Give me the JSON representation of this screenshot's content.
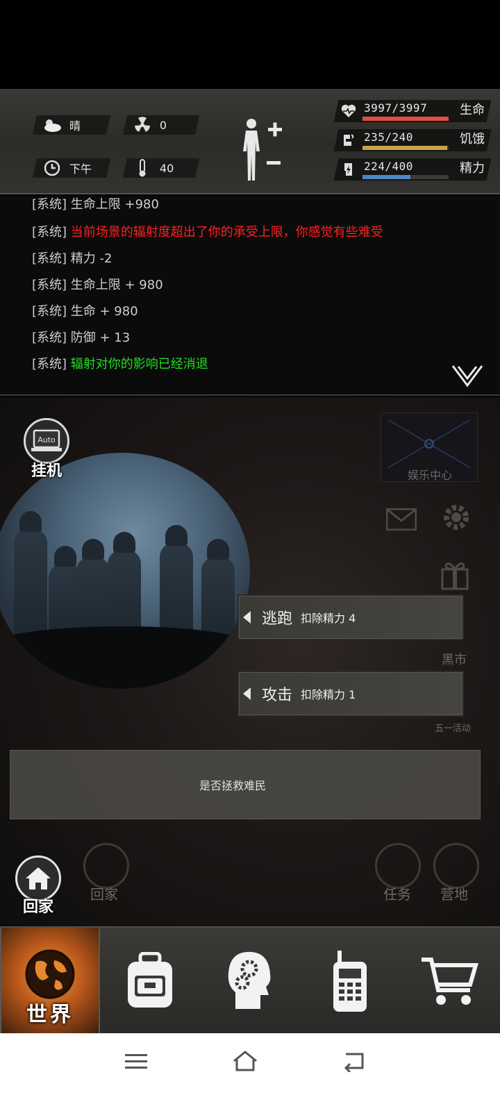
{
  "status": {
    "weather": "晴",
    "radiation": "0",
    "time_of_day": "下午",
    "temperature": "40",
    "health": {
      "value": "3997/3997",
      "label": "生命",
      "fill": 1.0,
      "color": "#e0503c"
    },
    "hunger": {
      "value": "235/240",
      "label": "饥饿",
      "fill": 0.98,
      "color": "#caa24a"
    },
    "energy": {
      "value": "224/400",
      "label": "精力",
      "fill": 0.56,
      "color": "#4f86c6"
    }
  },
  "log": {
    "partial_top": "[系统] 生命上限 +980",
    "lines": [
      {
        "tag": "[系统]",
        "msg": "当前场景的辐射度超出了你的承受上限，你感觉有些难受"
      },
      {
        "tag": "[系统]",
        "msg": "精力 -2"
      },
      {
        "tag": "[系统]",
        "msg": "生命上限 + 980"
      },
      {
        "tag": "[系统]",
        "msg": "生命 + 980"
      },
      {
        "tag": "[系统]",
        "msg": "防御 + 13"
      },
      {
        "tag": "[系统]",
        "msg": "辐射对你的影响已经消退"
      }
    ]
  },
  "scene": {
    "auto_icon_text": "Auto",
    "auto_label": "挂机",
    "entertainment": "娱乐中心",
    "black_market": "黑市",
    "may_day_event": "五一活动",
    "ghost_home": "回家",
    "ghost_quest": "任务",
    "ghost_camp": "营地",
    "home_label": "回家"
  },
  "actions": [
    {
      "name": "逃跑",
      "cost": "扣除精力 4"
    },
    {
      "name": "攻击",
      "cost": "扣除精力 1"
    }
  ],
  "prompt": "是否拯救难民",
  "nav": {
    "world": "世界"
  },
  "icons": [
    "weather-cloud-icon",
    "radiation-icon",
    "clock-icon",
    "thermometer-icon",
    "body-icon",
    "heart-icon",
    "hunger-icon",
    "energy-icon",
    "backpack-icon",
    "brain-icon",
    "radio-icon",
    "cart-icon",
    "globe-icon",
    "home-icon",
    "mail-icon",
    "settings-icon",
    "gift-icon"
  ]
}
